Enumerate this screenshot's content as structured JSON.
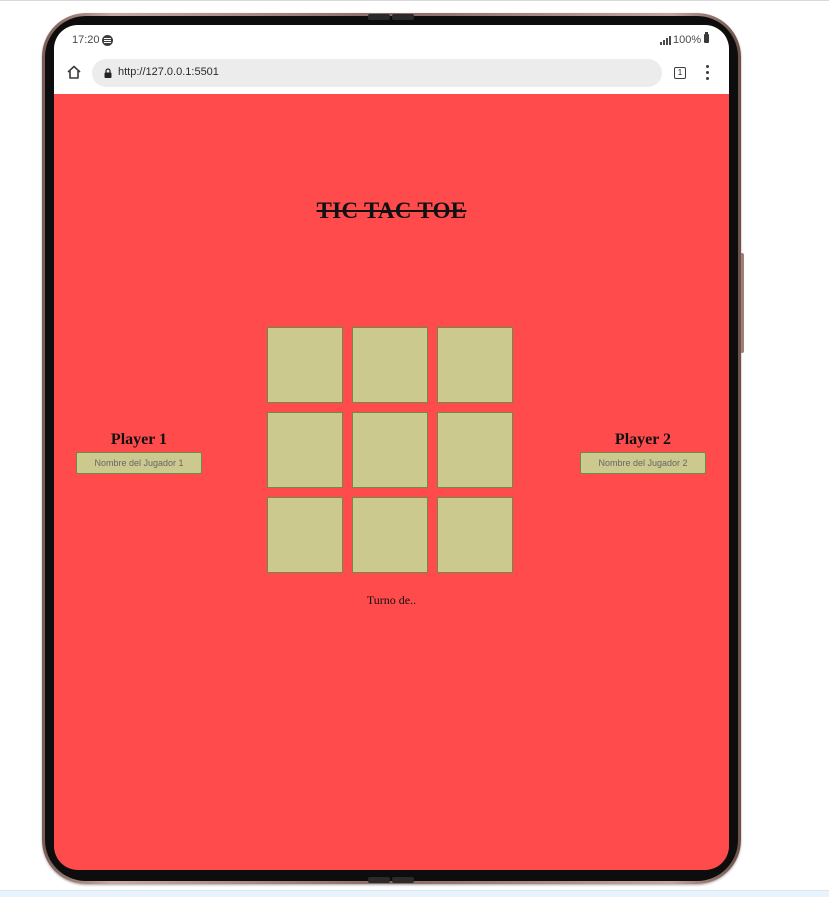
{
  "status_bar": {
    "time": "17:20",
    "battery": "100%",
    "icons": [
      "spotify-icon",
      "signal-icon",
      "battery-icon"
    ]
  },
  "browser": {
    "url": "http://127.0.0.1:5501",
    "tab_count": "1",
    "icons": [
      "home-icon",
      "lock-icon",
      "tabs-icon",
      "menu-icon"
    ]
  },
  "page": {
    "background_color": "#ff4b4b",
    "title": "TIC TAC TOE",
    "board": {
      "cell_color": "#cbc98e",
      "cells": [
        "",
        "",
        "",
        "",
        "",
        "",
        "",
        "",
        ""
      ]
    },
    "player1": {
      "label": "Player 1",
      "placeholder": "Nombre del Jugador 1",
      "value": ""
    },
    "player2": {
      "label": "Player 2",
      "placeholder": "Nombre del Jugador 2",
      "value": ""
    },
    "turn_text": "Turno de.."
  }
}
